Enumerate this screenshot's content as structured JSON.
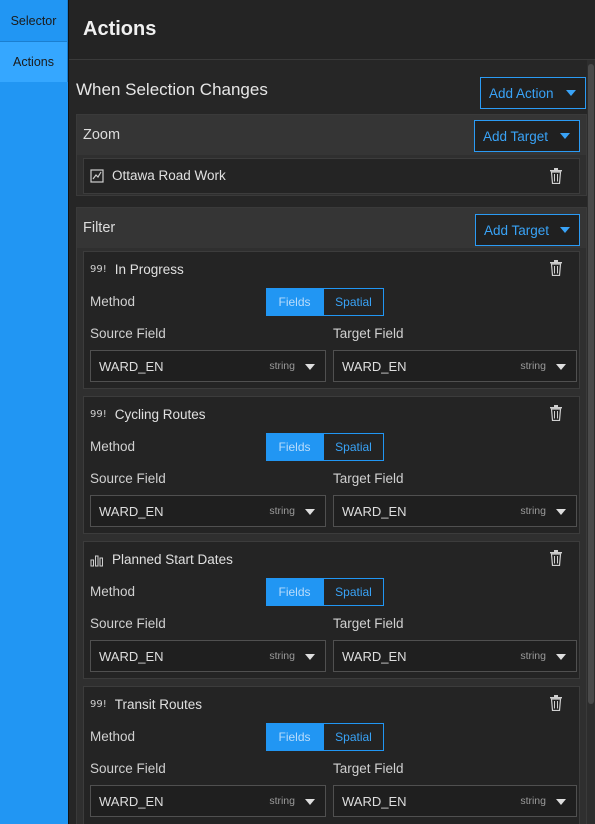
{
  "sidebar": {
    "tabs": [
      {
        "label": "Selector"
      },
      {
        "label": "Actions"
      }
    ]
  },
  "header": {
    "title": "Actions"
  },
  "section": {
    "title": "When Selection Changes",
    "add_action_label": "Add Action"
  },
  "zoom": {
    "title": "Zoom",
    "add_target_label": "Add Target",
    "target": {
      "name": "Ottawa Road Work",
      "icon": "map-icon"
    }
  },
  "filter": {
    "title": "Filter",
    "add_target_label": "Add Target",
    "method_label": "Method",
    "source_label": "Source Field",
    "target_label": "Target Field",
    "method_options": [
      "Fields",
      "Spatial"
    ],
    "targets": [
      {
        "icon_text": "99!",
        "name": "In Progress",
        "source": {
          "value": "WARD_EN",
          "type": "string"
        },
        "target": {
          "value": "WARD_EN",
          "type": "string"
        }
      },
      {
        "icon_text": "99!",
        "name": "Cycling Routes",
        "source": {
          "value": "WARD_EN",
          "type": "string"
        },
        "target": {
          "value": "WARD_EN",
          "type": "string"
        }
      },
      {
        "icon_text": "chart-icon",
        "name": "Planned Start Dates",
        "source": {
          "value": "WARD_EN",
          "type": "string"
        },
        "target": {
          "value": "WARD_EN",
          "type": "string"
        }
      },
      {
        "icon_text": "99!",
        "name": "Transit Routes",
        "source": {
          "value": "WARD_EN",
          "type": "string"
        },
        "target": {
          "value": "WARD_EN",
          "type": "string"
        }
      }
    ]
  },
  "colors": {
    "accent": "#2196f3",
    "background": "#262626"
  }
}
